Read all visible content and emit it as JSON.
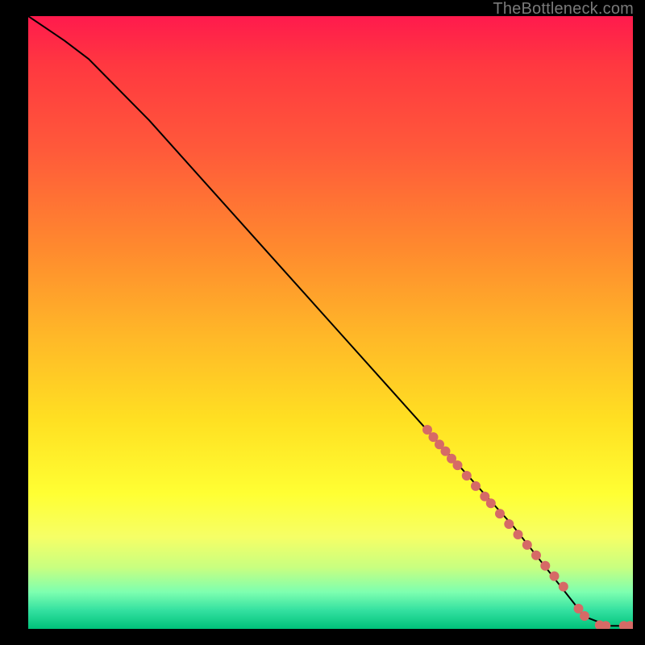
{
  "attribution": "TheBottleneck.com",
  "chart_data": {
    "type": "line",
    "title": "",
    "xlabel": "",
    "ylabel": "",
    "xlim": [
      0,
      100
    ],
    "ylim": [
      0,
      100
    ],
    "series": [
      {
        "name": "bottleneck-curve",
        "x": [
          0,
          3,
          6,
          10,
          15,
          20,
          30,
          40,
          50,
          60,
          70,
          80,
          88,
          92,
          96,
          100
        ],
        "y": [
          100,
          98,
          96,
          93,
          88,
          83,
          72,
          61,
          50,
          39,
          28,
          17,
          7,
          2,
          0.5,
          0.5
        ],
        "color": "#000000"
      }
    ],
    "highlight_points": {
      "name": "sample-dots",
      "color": "#d66a66",
      "radius_px": 6,
      "points": [
        {
          "x": 66,
          "y": 32.5
        },
        {
          "x": 67,
          "y": 31.3
        },
        {
          "x": 68,
          "y": 30.1
        },
        {
          "x": 69,
          "y": 29.0
        },
        {
          "x": 70,
          "y": 27.8
        },
        {
          "x": 71,
          "y": 26.7
        },
        {
          "x": 72.5,
          "y": 25.0
        },
        {
          "x": 74,
          "y": 23.3
        },
        {
          "x": 75.5,
          "y": 21.6
        },
        {
          "x": 76.5,
          "y": 20.5
        },
        {
          "x": 78,
          "y": 18.8
        },
        {
          "x": 79.5,
          "y": 17.1
        },
        {
          "x": 81,
          "y": 15.4
        },
        {
          "x": 82.5,
          "y": 13.7
        },
        {
          "x": 84,
          "y": 12.0
        },
        {
          "x": 85.5,
          "y": 10.3
        },
        {
          "x": 87,
          "y": 8.6
        },
        {
          "x": 88.5,
          "y": 6.9
        },
        {
          "x": 91,
          "y": 3.3
        },
        {
          "x": 92,
          "y": 2.1
        },
        {
          "x": 94.5,
          "y": 0.6
        },
        {
          "x": 95.5,
          "y": 0.5
        },
        {
          "x": 98.5,
          "y": 0.5
        },
        {
          "x": 99.5,
          "y": 0.5
        }
      ]
    }
  }
}
